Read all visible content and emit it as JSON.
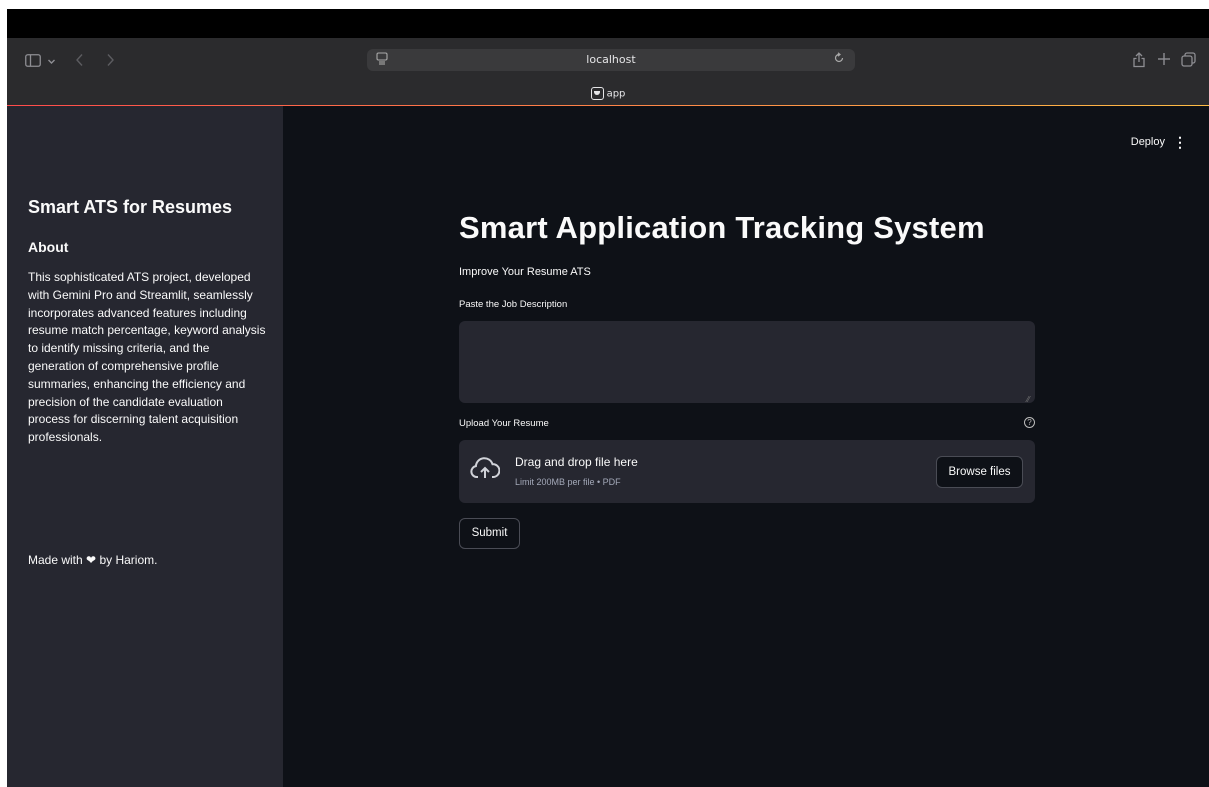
{
  "browser": {
    "url": "localhost",
    "tab_title": "app",
    "icons": [
      "sidebar-icon",
      "chevron-down-icon",
      "back-icon",
      "forward-icon",
      "site-settings-icon",
      "reload-icon",
      "share-icon",
      "new-tab-icon",
      "tabs-overview-icon"
    ]
  },
  "sidebar": {
    "title": "Smart ATS for Resumes",
    "about_heading": "About",
    "about_text": "This sophisticated ATS project, developed with Gemini Pro and Streamlit, seamlessly incorporates advanced features including resume match percentage, keyword analysis to identify missing criteria, and the generation of comprehensive profile summaries, enhancing the efficiency and precision of the candidate evaluation process for discerning talent acquisition professionals.",
    "made_with_prefix": "Made with",
    "made_with_suffix": "by Hariom."
  },
  "header": {
    "deploy_label": "Deploy"
  },
  "main": {
    "title": "Smart Application Tracking System",
    "subtitle": "Improve Your Resume ATS",
    "job_description_label": "Paste the Job Description",
    "job_description_value": "",
    "upload_label": "Upload Your Resume",
    "dropzone_title": "Drag and drop file here",
    "dropzone_limit": "Limit 200MB per file • PDF",
    "browse_label": "Browse files",
    "submit_label": "Submit"
  },
  "colors": {
    "app_background": "#0e1117",
    "sidebar_background": "#262730",
    "input_background": "#262730",
    "text": "#fafafa",
    "accent_gradient_start": "#ff4b4b",
    "accent_gradient_end": "#ffbd45"
  }
}
